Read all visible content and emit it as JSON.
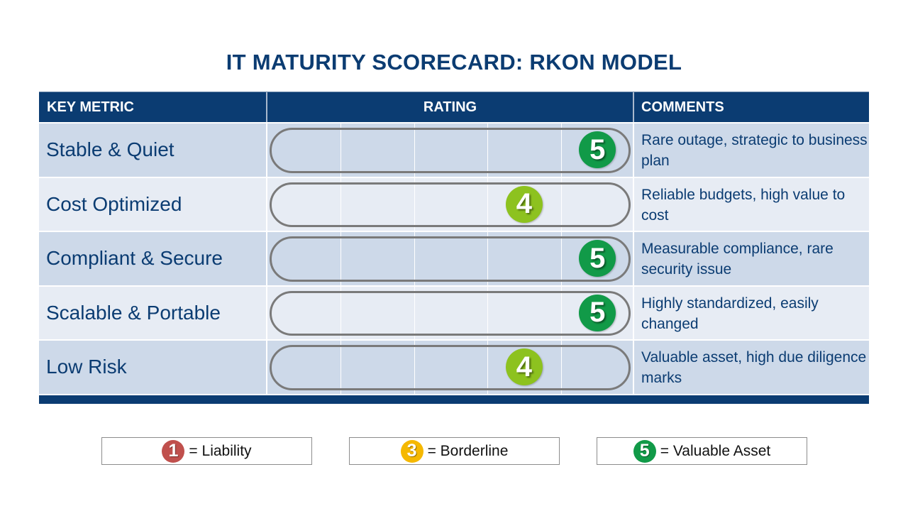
{
  "title": "IT MATURITY SCORECARD: RKON MODEL",
  "table": {
    "headers": {
      "metric": "KEY METRIC",
      "rating": "RATING",
      "comments": "COMMENTS"
    },
    "scale_max": 5,
    "rows": [
      {
        "metric": "Stable & Quiet",
        "rating": 5,
        "rating_label": "5",
        "comment": "Rare outage, strategic to business plan"
      },
      {
        "metric": "Cost Optimized",
        "rating": 4,
        "rating_label": "4",
        "comment": "Reliable budgets, high value to cost"
      },
      {
        "metric": "Compliant & Secure",
        "rating": 5,
        "rating_label": "5",
        "comment": "Measurable compliance, rare security issue"
      },
      {
        "metric": "Scalable & Portable",
        "rating": 5,
        "rating_label": "5",
        "comment": "Highly standardized, easily changed"
      },
      {
        "metric": "Low Risk",
        "rating": 4,
        "rating_label": "4",
        "comment": "Valuable asset, high due diligence marks"
      }
    ]
  },
  "rating_colors": {
    "1": "#c0504d",
    "3": "#f5b800",
    "4": "#8dc21f",
    "5": "#119a48"
  },
  "legend": [
    {
      "value": "1",
      "label": "= Liability"
    },
    {
      "value": "3",
      "label": "= Borderline"
    },
    {
      "value": "5",
      "label": "= Valuable Asset"
    }
  ]
}
